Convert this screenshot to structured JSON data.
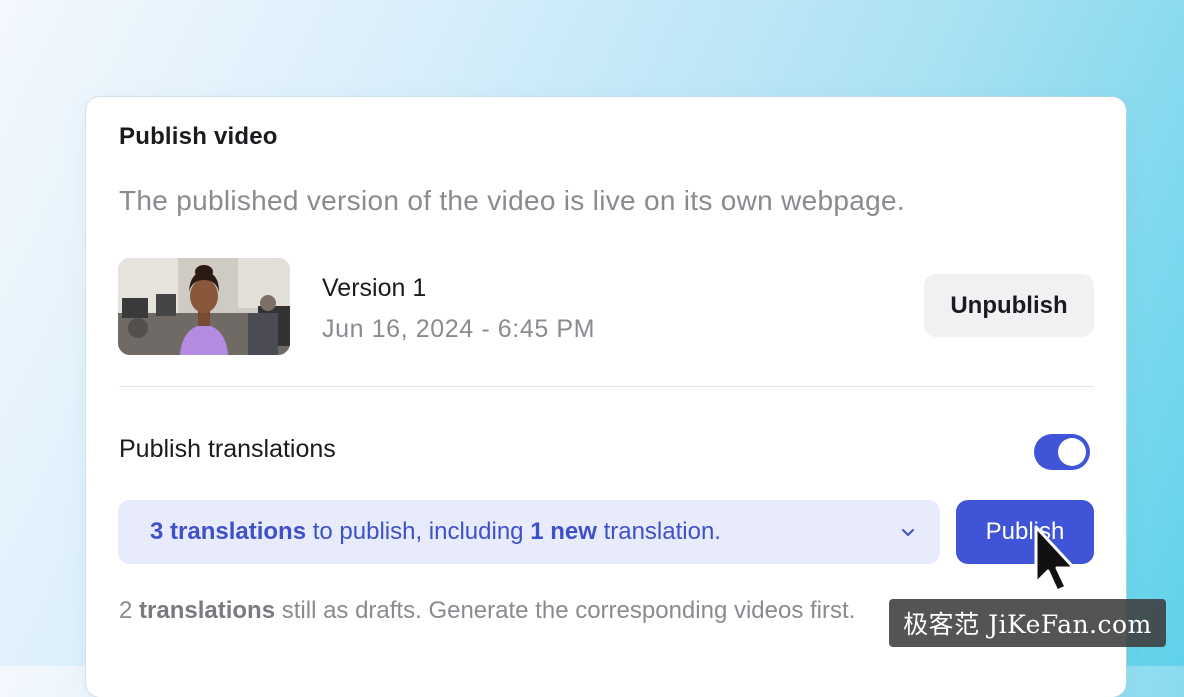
{
  "dialog": {
    "title": "Publish video",
    "subtitle": "The published version of the video is live on its own webpage."
  },
  "version": {
    "name": "Version 1",
    "date": "Jun 16, 2024 - 6:45 PM",
    "unpublish_label": "Unpublish"
  },
  "translations": {
    "label": "Publish translations",
    "toggle_on": true,
    "select": {
      "count_text": "3 translations",
      "middle_text": " to publish, including ",
      "new_text": "1 new",
      "end_text": " translation."
    },
    "publish_label": "Publish",
    "drafts": {
      "count": "2",
      "bold_text": " translations",
      "rest": " still as drafts. Generate the corresponding videos first."
    }
  },
  "watermark": "极客范 JiKeFan.com",
  "colors": {
    "accent": "#3f54d6",
    "select_bg": "#e8ebfb",
    "select_text": "#3f51c9",
    "muted_text": "#8a8a90"
  },
  "icons": {
    "dropdown": "chevron-down-icon",
    "cursor": "mouse-pointer-icon"
  }
}
